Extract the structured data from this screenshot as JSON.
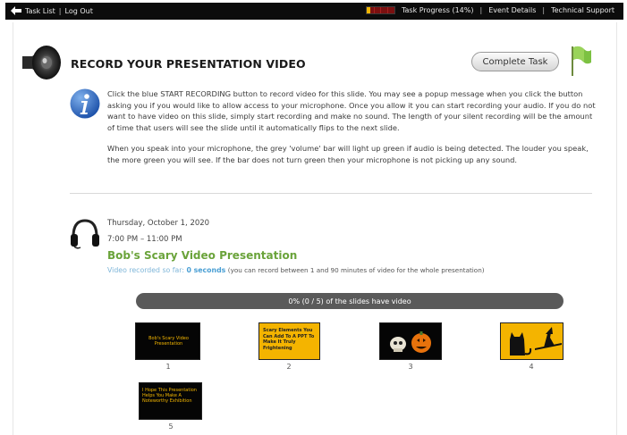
{
  "topbar": {
    "task_list": "Task List",
    "separator": "|",
    "log_out": "Log Out",
    "task_progress": "Task Progress (14%)",
    "task_progress_fraction": 0.14,
    "event_details": "Event Details",
    "technical_support": "Technical Support"
  },
  "header": {
    "title": "RECORD YOUR PRESENTATION VIDEO",
    "complete_button": "Complete Task"
  },
  "instructions": {
    "paragraph1": "Click the blue START RECORDING button to record video for this slide. You may see a popup message when you click the button asking you if you would like to allow access to your microphone. Once you allow it you can start recording your audio. If you do not want to have video on this slide, simply start recording and make no sound. The length of your silent recording will be the amount of time that users will see the slide until it automatically flips to the next slide.",
    "paragraph2": "When you speak into your microphone, the grey 'volume' bar will light up green if audio is being detected. The louder you speak, the more green you will see. If the bar does not turn green then your microphone is not picking up any sound."
  },
  "event": {
    "date": "Thursday, October 1, 2020",
    "time": "7:00 PM – 11:00 PM",
    "name": "Bob's Scary Video Presentation",
    "recorded_label": "Video recorded so far:",
    "recorded_value": "0 seconds",
    "recorded_note": "(you can record between 1 and 90 minutes of video for the whole presentation)"
  },
  "slides_progress": "0% (0 / 5) of the slides have video",
  "slides": [
    {
      "number": "1",
      "thumb_text": "Bob's Scary Video Presentation"
    },
    {
      "number": "2",
      "thumb_text": "Scary Elements You Can Add To A PPT To Make It Truly Frightening"
    },
    {
      "number": "3",
      "thumb_text": ""
    },
    {
      "number": "4",
      "thumb_text": ""
    },
    {
      "number": "5",
      "thumb_text": "I Hope This Presentation Helps You Make A Noteworthy Exhibition"
    }
  ],
  "icons": [
    "back-arrow-icon",
    "speaker-icon",
    "flag-icon",
    "info-icon",
    "headphones-icon"
  ],
  "colors": {
    "topbar_bg": "#0c0c0c",
    "accent_green": "#6aa33a",
    "link_blue": "#4a9fd4",
    "slide_yellow": "#f4b400"
  }
}
